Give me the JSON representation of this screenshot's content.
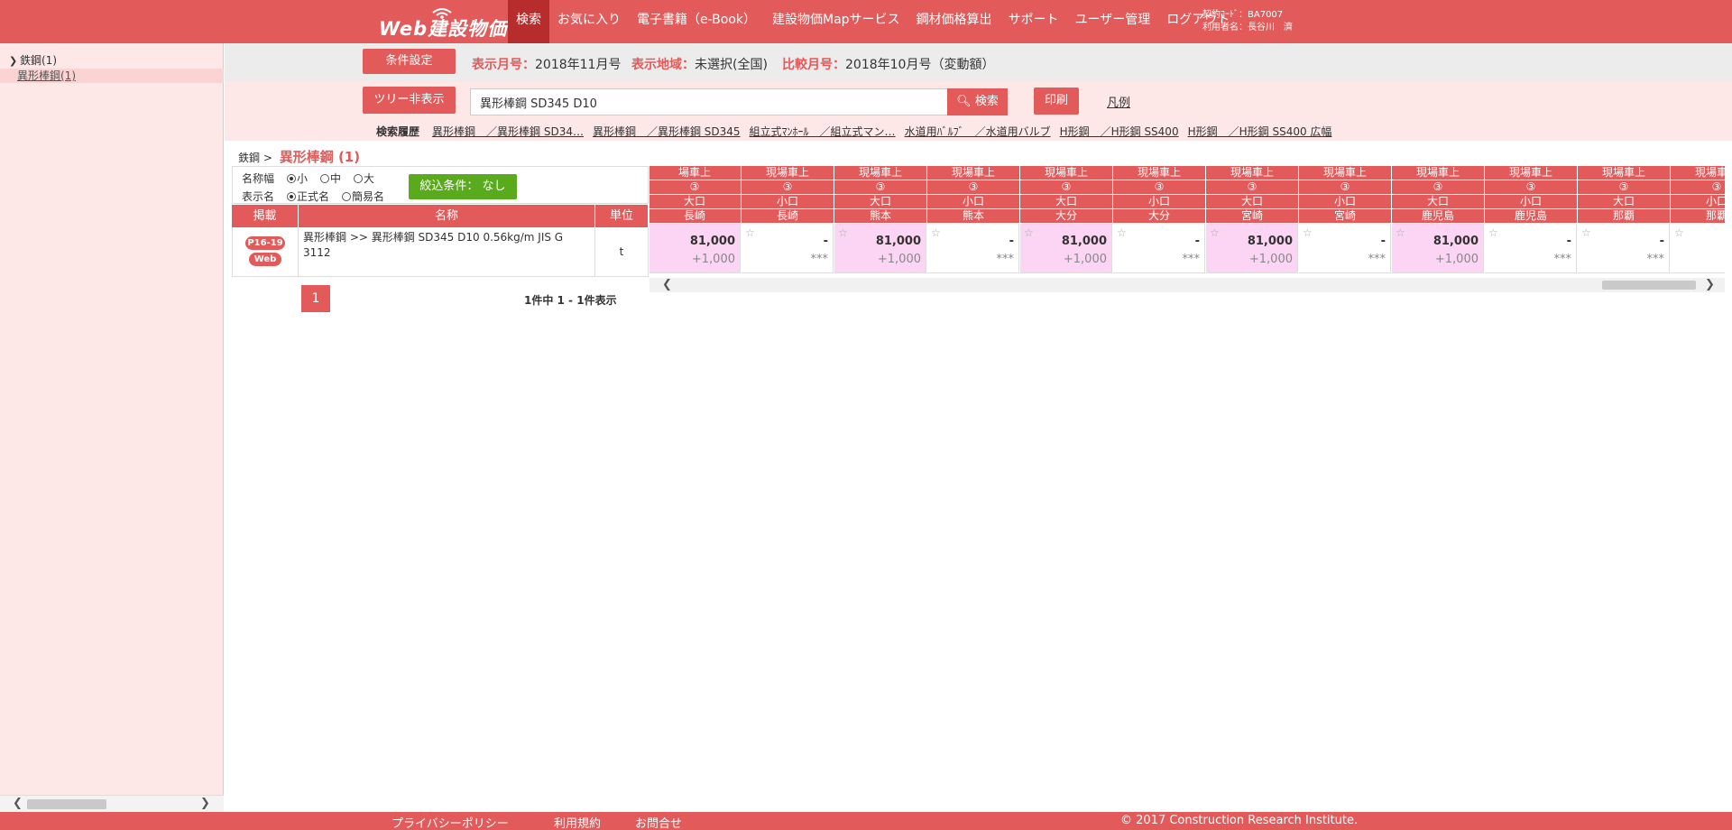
{
  "header": {
    "logo_text": "Web建設物価",
    "nav": [
      "検索",
      "お気に入り",
      "電子書籍（e-Book）",
      "建設物価Mapサービス",
      "鋼材価格算出",
      "サポート",
      "ユーザー管理",
      "ログアウト"
    ],
    "account_code_label": "契約ｺｰﾄﾞ：BA7007",
    "account_user_label": "利用者名：長谷川　濟"
  },
  "sidebar": {
    "root_label": "鉄鋼(1)",
    "child_label": "異形棒鋼(1)"
  },
  "conditions": {
    "settings_button": "条件設定",
    "display_month_key": "表示月号：",
    "display_month_value": "2018年11月号",
    "region_key": "表示地域：",
    "region_value": "未選択(全国)",
    "compare_key": "比較月号：",
    "compare_value": "2018年10月号（変動額）"
  },
  "search": {
    "tree_toggle_button": "ツリー非表示",
    "query": "異形棒鋼 SD345 D10",
    "search_button": "検索",
    "print_button": "印刷",
    "legend_link": "凡例",
    "history_label": "検索履歴",
    "history": [
      "異形棒鋼　／異形棒鋼 SD34…",
      "異形棒鋼　／異形棒鋼 SD345",
      "組立式ﾏﾝﾎｰﾙ　／組立式マン…",
      "水道用ﾊﾞﾙﾌﾞ　／水道用バルブ",
      "H形鋼　／H形鋼 SS400",
      "H形鋼　／H形鋼 SS400 広幅"
    ]
  },
  "breadcrumb": {
    "parent": "鉄鋼",
    "separator": ">",
    "current": "異形棒鋼 (1)"
  },
  "options": {
    "name_width_label": "名称幅",
    "name_width_small": "小",
    "name_width_mid": "中",
    "name_width_large": "大",
    "display_name_label": "表示名",
    "display_name_formal": "正式名",
    "display_name_short": "簡易名",
    "filter_button": "絞込条件： なし"
  },
  "table": {
    "headers": [
      "掲載",
      "名称",
      "単位"
    ],
    "row": {
      "badge_page": "P16-19",
      "badge_web": "Web",
      "name": "異形棒鋼 >> 異形棒鋼 SD345 D10 0.56kg/m JIS G 3112",
      "unit": "t"
    }
  },
  "price_grid": {
    "columns": [
      {
        "delivery": "場車上",
        "mark": "③",
        "size": "大口",
        "city": "長崎",
        "price": "81,000",
        "diff": "+1,000",
        "star": false,
        "highlight": true
      },
      {
        "delivery": "現場車上",
        "mark": "③",
        "size": "小口",
        "city": "長崎",
        "price": "-",
        "diff": "***",
        "star": true,
        "highlight": false
      },
      {
        "delivery": "現場車上",
        "mark": "③",
        "size": "大口",
        "city": "熊本",
        "price": "81,000",
        "diff": "+1,000",
        "star": true,
        "highlight": true
      },
      {
        "delivery": "現場車上",
        "mark": "③",
        "size": "小口",
        "city": "熊本",
        "price": "-",
        "diff": "***",
        "star": true,
        "highlight": false
      },
      {
        "delivery": "現場車上",
        "mark": "③",
        "size": "大口",
        "city": "大分",
        "price": "81,000",
        "diff": "+1,000",
        "star": true,
        "highlight": true
      },
      {
        "delivery": "現場車上",
        "mark": "③",
        "size": "小口",
        "city": "大分",
        "price": "-",
        "diff": "***",
        "star": true,
        "highlight": false
      },
      {
        "delivery": "現場車上",
        "mark": "③",
        "size": "大口",
        "city": "宮崎",
        "price": "81,000",
        "diff": "+1,000",
        "star": true,
        "highlight": true
      },
      {
        "delivery": "現場車上",
        "mark": "③",
        "size": "小口",
        "city": "宮崎",
        "price": "-",
        "diff": "***",
        "star": true,
        "highlight": false
      },
      {
        "delivery": "現場車上",
        "mark": "③",
        "size": "大口",
        "city": "鹿児島",
        "price": "81,000",
        "diff": "+1,000",
        "star": true,
        "highlight": true
      },
      {
        "delivery": "現場車上",
        "mark": "③",
        "size": "小口",
        "city": "鹿児島",
        "price": "-",
        "diff": "***",
        "star": true,
        "highlight": false
      },
      {
        "delivery": "現場車上",
        "mark": "③",
        "size": "大口",
        "city": "那覇",
        "price": "-",
        "diff": "***",
        "star": true,
        "highlight": false
      },
      {
        "delivery": "現場車上",
        "mark": "③",
        "size": "小口",
        "city": "那覇",
        "price": "-",
        "diff": "***",
        "star": true,
        "highlight": false
      }
    ]
  },
  "pager": {
    "current_page": "1",
    "count_text": "1件中 1 - 1件表示"
  },
  "footer": {
    "privacy": "プライバシーポリシー",
    "terms": "利用規約",
    "contact": "お問合せ",
    "copyright": "© 2017 Construction Research Institute."
  },
  "colors": {
    "accent": "#e25a5a",
    "nav_active": "#b72c2c",
    "highlight": "#fcd4f4",
    "filter": "#5aaa1e"
  }
}
